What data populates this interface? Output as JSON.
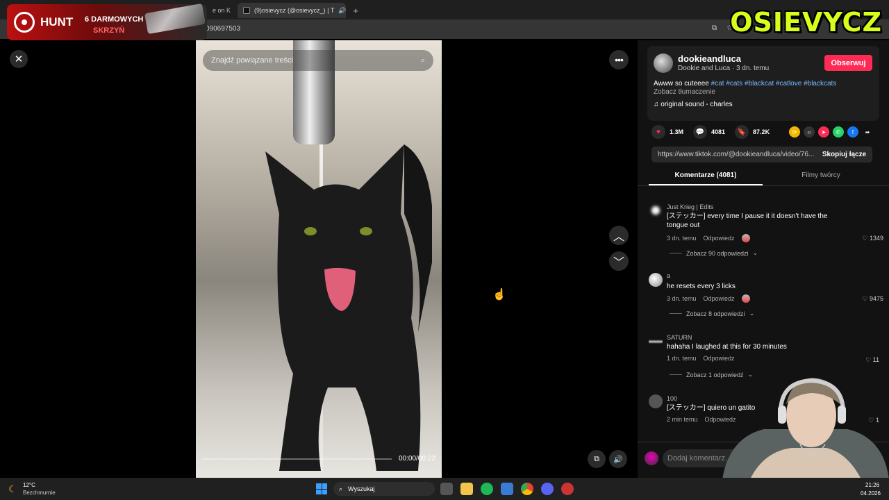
{
  "browser": {
    "tabs": [
      {
        "label": "",
        "active": false
      },
      {
        "label": "",
        "active": false
      },
      {
        "label": "e on K",
        "active": false
      },
      {
        "label": "(9)osievycz (@osievycz_) | T",
        "active": true
      }
    ],
    "new_tab": "+",
    "url": "090697503"
  },
  "sponsor": {
    "brand": "HUNT",
    "line1": "6 DARMOWYCH",
    "line2": "SKRZYŃ",
    "logo_text": "OSIEVYCZ"
  },
  "video": {
    "search_placeholder": "Znajdź powiązane treści",
    "timecode": "00:00/00:22",
    "progress": 0
  },
  "post": {
    "author": "dookieandluca",
    "author_sub": "Dookie and Luca · 3 dn. temu",
    "follow": "Obserwuj",
    "caption_text": "Awww so cuteeee ",
    "hashtags": [
      "#cat",
      "#cats",
      "#blackcat",
      "#catlove",
      "#blackcats"
    ],
    "translate": "Zobacz tłumaczenie",
    "sound": "original sound - charles",
    "likes": "1.3M",
    "comments": "4081",
    "saves": "87.2K",
    "link": "https://www.tiktok.com/@dookieandluca/video/76...",
    "copy": "Skopiuj łącze"
  },
  "tabs": {
    "comments": "Komentarze (4081)",
    "creator": "Filmy twórcy"
  },
  "comments": [
    {
      "user": "Just Krieg | Edits",
      "text": "[ステッカー] every time I pause it it doesn't have the tongue out",
      "time": "3 dn. temu",
      "reply": "Odpowiedz",
      "likes": "1349",
      "more": "Zobacz 90 odpowiedzi"
    },
    {
      "user": "a",
      "text": "he resets every 3 licks",
      "time": "3 dn. temu",
      "reply": "Odpowiedz",
      "likes": "9475",
      "more": "Zobacz 8 odpowiedzi"
    },
    {
      "user": "SATURN",
      "text": "hahaha I laughed at this for 30 minutes",
      "time": "1 dn. temu",
      "reply": "Odpowiedz",
      "likes": "11",
      "more": "Zobacz 1 odpowiedź"
    },
    {
      "user": "100",
      "text": "[ステッカー] quiero un gatito",
      "time": "2 min temu",
      "reply": "Odpowiedz",
      "likes": "1",
      "more": ""
    }
  ],
  "comment_input_placeholder": "Dodaj komentarz...",
  "taskbar": {
    "temp": "12°C",
    "condition": "Bezchmurnie",
    "search": "Wyszukaj",
    "time": "21:26",
    "date": "04.2026"
  },
  "colors": {
    "accent": "#fe2c55",
    "hashtag": "#79b8ff",
    "logo": "#d6ff1a"
  }
}
